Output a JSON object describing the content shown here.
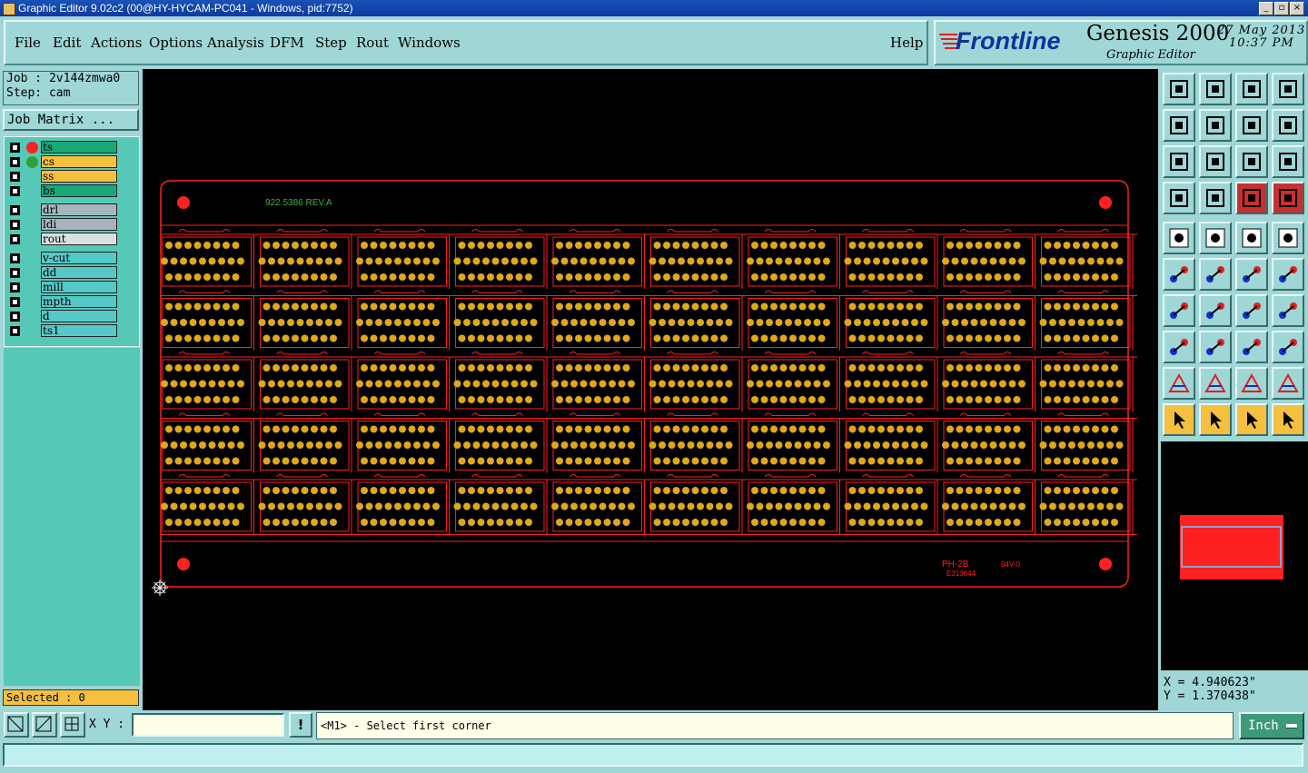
{
  "window": {
    "title": "Graphic Editor 9.02c2 (00@HY-HYCAM-PC041 - Windows, pid:7752)"
  },
  "menu": {
    "items": [
      "File",
      "Edit",
      "Actions",
      "Options",
      "Analysis",
      "DFM",
      "Step",
      "Rout",
      "Windows"
    ],
    "help": "Help"
  },
  "brand": {
    "logo": "Frontline",
    "product": "Genesis 2000",
    "subtitle": "Graphic Editor",
    "date": "27 May 2013",
    "time": "10:37 PM"
  },
  "job": {
    "job_label": "Job : 2v144zmwa0",
    "step_label": "Step: cam",
    "matrix_button": "Job Matrix ..."
  },
  "layers": [
    {
      "name": "ts",
      "color": "#18a878",
      "dot": "#ff2020"
    },
    {
      "name": "cs",
      "color": "#f5c040",
      "dot": "#30a030"
    },
    {
      "name": "ss",
      "color": "#f5c040",
      "dot": ""
    },
    {
      "name": "bs",
      "color": "#18a878",
      "dot": ""
    },
    {
      "name": "drl",
      "color": "#a8b4bc",
      "dot": ""
    },
    {
      "name": "ldi",
      "color": "#a8b4bc",
      "dot": ""
    },
    {
      "name": "rout",
      "color": "#d8e0e0",
      "dot": ""
    },
    {
      "name": "v-cut",
      "color": "#56c8c8",
      "dot": ""
    },
    {
      "name": "dd",
      "color": "#56c8c8",
      "dot": ""
    },
    {
      "name": "mill",
      "color": "#56c8c8",
      "dot": ""
    },
    {
      "name": "mpth",
      "color": "#56c8c8",
      "dot": ""
    },
    {
      "name": "d",
      "color": "#56c8c8",
      "dot": ""
    },
    {
      "name": "ts1",
      "color": "#56c8c8",
      "dot": ""
    }
  ],
  "selected_label": "Selected : 0",
  "board": {
    "top_text": "922.5386 REV.A",
    "bottom_text1": "PH-2B",
    "bottom_text2": "E313644",
    "bottom_text3": "94V-0",
    "panel_columns": 10,
    "panel_rows": 5,
    "colors": {
      "outline": "#ff2020",
      "pad": "#e0a818",
      "text": "#40b040"
    }
  },
  "coords": {
    "x": "X = 4.940623\"",
    "y": "Y = 1.370438\""
  },
  "bottom": {
    "xy_label": "X Y :",
    "xy_value": "",
    "prompt": "<M1> - Select first corner",
    "units": "Inch",
    "warn": "!"
  }
}
